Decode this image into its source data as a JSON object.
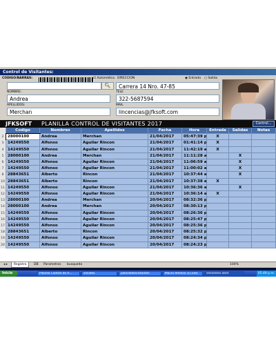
{
  "form": {
    "title": "Control de Visitantes:",
    "barcode_label": "CODIGO/BARRAS:",
    "automatic_label": "Automático",
    "direction_label": "DIRECCION",
    "direction_value": "Carrera 14 Nro. 47-85",
    "entrada_label": "Entrada",
    "salida_label": "Salida",
    "nombre_label": "NOMBRE:",
    "nombre_value": "Andrea",
    "tel_label": "TELE",
    "tel_value": "322-5687594",
    "apellidos_label": "APELLIDOS:",
    "apellidos_value": "Merchan",
    "mail_label": "MAIL",
    "mail_value": "lincencias@jfksoft.com",
    "search_icon": "magnifier-icon"
  },
  "sheet": {
    "logo": "JFKSOFT",
    "title": "PLANILLA CONTROL DE VISITANTES 2017",
    "control_button": "Control...",
    "headers": [
      "Codigo",
      "Nombres",
      "Apellidos",
      "Fecha",
      "Hora",
      "Entrada",
      "Salidas",
      "Notas"
    ],
    "rows": [
      {
        "n": "2",
        "c": [
          "28000100",
          "Andrea",
          "Merchan",
          "21/04/2017",
          "05:47:39 p.m.",
          "X",
          "",
          ""
        ]
      },
      {
        "n": "3",
        "c": [
          "14249550",
          "Alfonso",
          "Aguilar Rincon",
          "21/04/2017",
          "01:41:14 p.m.",
          "X",
          "",
          ""
        ]
      },
      {
        "n": "4",
        "c": [
          "14249550",
          "Alfonso",
          "Aguilar Rincon",
          "21/04/2017",
          "11:42:19 a.m.",
          "X",
          "",
          ""
        ]
      },
      {
        "n": "5",
        "c": [
          "28000100",
          "Andrea",
          "Merchan",
          "21/04/2017",
          "11:11:28 a.m.",
          "",
          "X",
          ""
        ]
      },
      {
        "n": "6",
        "c": [
          "14249550",
          "Alfonso",
          "Aguilar Rincon",
          "21/04/2017",
          "11:06:59 a.m.",
          "",
          "X",
          ""
        ]
      },
      {
        "n": "7",
        "c": [
          "14249550",
          "Alfonso",
          "Aguilar Rincon",
          "21/04/2017",
          "11:00:02 a.m.",
          "",
          "X",
          ""
        ]
      },
      {
        "n": "8",
        "c": [
          "28843651",
          "Alberto",
          "Rincon",
          "21/04/2017",
          "10:37:44 a.m.",
          "",
          "X",
          ""
        ]
      },
      {
        "n": "10",
        "c": [
          "28843651",
          "Alberto",
          "Rincon",
          "21/04/2017",
          "10:37:38 a.m.",
          "X",
          "",
          ""
        ]
      },
      {
        "n": "11",
        "c": [
          "14249550",
          "Alfonso",
          "Aguilar Rincon",
          "21/04/2017",
          "10:36:36 a.m.",
          "",
          "X",
          ""
        ]
      },
      {
        "n": "12",
        "c": [
          "14249550",
          "Alfonso",
          "Aguilar Rincon",
          "21/04/2017",
          "10:36:14 a.m.",
          "X",
          "",
          ""
        ]
      },
      {
        "n": "13",
        "c": [
          "28000100",
          "Andrea",
          "Merchan",
          "20/04/2017",
          "08:32:36 p.m.",
          "",
          "",
          ""
        ]
      },
      {
        "n": "14",
        "c": [
          "28000100",
          "Andrea",
          "Merchan",
          "20/04/2017",
          "08:30:13 p.m.",
          "",
          "",
          ""
        ]
      },
      {
        "n": "15",
        "c": [
          "14249550",
          "Alfonso",
          "Aguilar Rincon",
          "20/04/2017",
          "08:26:36 p.m.",
          "",
          "",
          ""
        ]
      },
      {
        "n": "16",
        "c": [
          "14249550",
          "Alfonso",
          "Aguilar Rincon",
          "20/04/2017",
          "08:25:47 p.m.",
          "",
          "",
          ""
        ]
      },
      {
        "n": "17",
        "c": [
          "14249550",
          "Alfonso",
          "Aguilar Rincon",
          "20/04/2017",
          "08:25:36 p.m.",
          "",
          "",
          ""
        ]
      },
      {
        "n": "18",
        "c": [
          "28843651",
          "Alberto",
          "Rincon",
          "20/04/2017",
          "08:25:32 p.m.",
          "",
          "",
          ""
        ]
      },
      {
        "n": "19",
        "c": [
          "14249550",
          "Alfonso",
          "Aguilar Rincon",
          "20/04/2017",
          "08:24:34 p.m.",
          "",
          "",
          ""
        ]
      },
      {
        "n": "20",
        "c": [
          "14249550",
          "Alfonso",
          "Aguilar Rincon",
          "20/04/2017",
          "08:24:23 p.m.",
          "",
          "",
          ""
        ]
      }
    ],
    "tabs": [
      "Registro",
      "DB",
      "Parametros",
      "busqueda"
    ],
    "zoom": "100%"
  },
  "taskbar": {
    "start": "Inicio",
    "tasks": [
      "Planilla Control de A...",
      "sonidos",
      "planilladevisitantes",
      "Macro Alfonso (1).xlsx",
      "Visitantes.xlsm"
    ],
    "clock": "05:49 p.m."
  }
}
